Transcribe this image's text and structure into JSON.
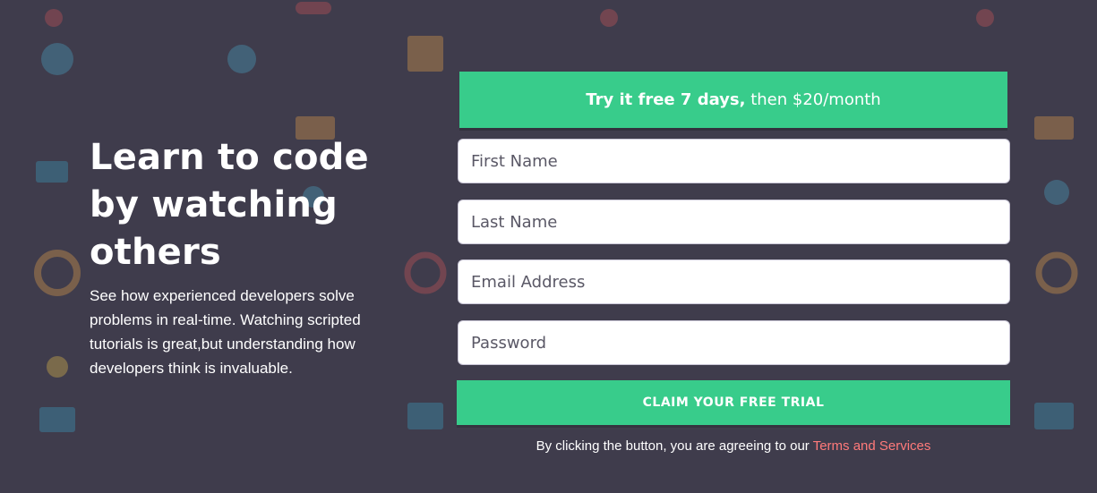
{
  "hero": {
    "title": "Learn to code by watching others",
    "description": "See how experienced developers solve problems in real-time. Watching scripted tutorials is great,but understanding how developers think is invaluable."
  },
  "offer": {
    "highlight": "Try it free 7 days,",
    "rest": " then $20/month"
  },
  "form": {
    "first_name_placeholder": "First Name",
    "last_name_placeholder": "Last Name",
    "email_placeholder": "Email Address",
    "password_placeholder": "Password",
    "submit_label": "CLAIM YOUR FREE TRIAL"
  },
  "terms": {
    "prefix": "By clicking the button, you are agreeing to our ",
    "link_label": "Terms and Services"
  },
  "colors": {
    "background": "#3f3c4c",
    "accent_green": "#38cc8b",
    "link_red": "#ff7a7a"
  }
}
